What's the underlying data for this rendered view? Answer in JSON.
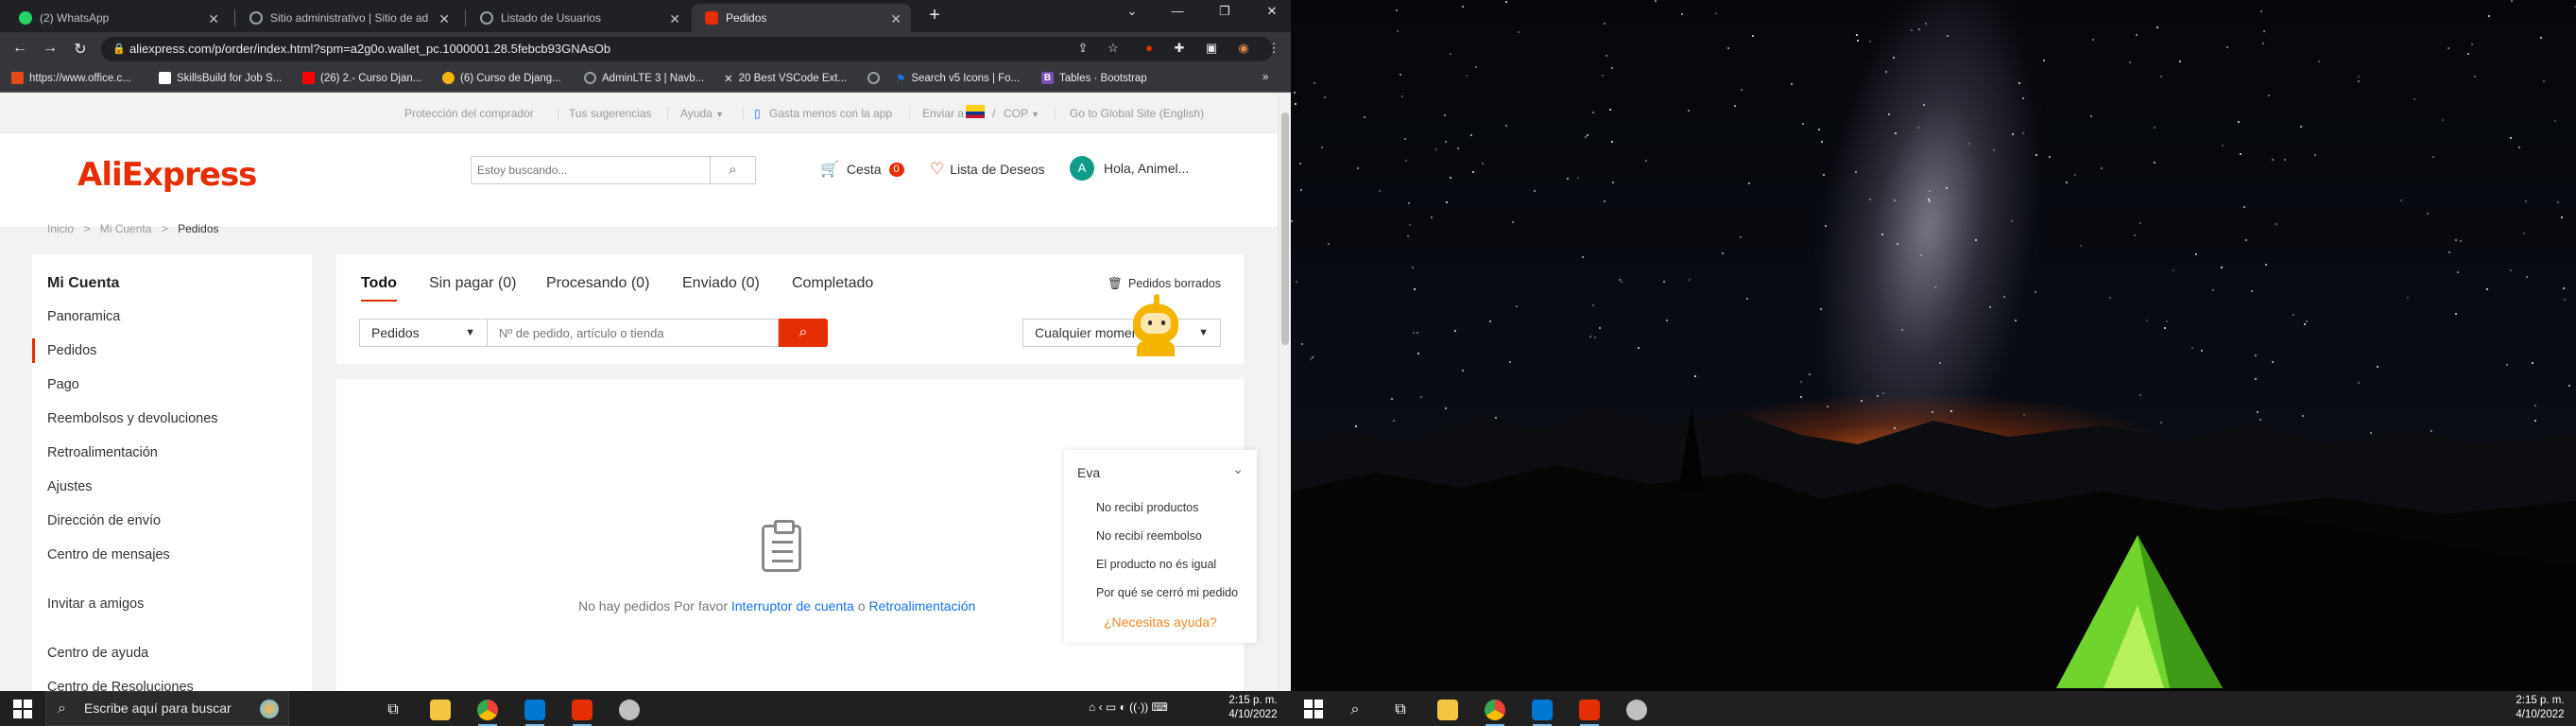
{
  "browser": {
    "tabs": [
      {
        "title": "(2) WhatsApp",
        "icon": "whatsapp-icon",
        "color": "#25d366"
      },
      {
        "title": "Sitio administrativo | Sitio de ad",
        "icon": "globe-icon",
        "color": "#9aa0a6"
      },
      {
        "title": "Listado de Usuarios",
        "icon": "globe-icon",
        "color": "#9aa0a6"
      },
      {
        "title": "Pedidos",
        "icon": "aliexpress-icon",
        "color": "#e62e04"
      }
    ],
    "url": "aliexpress.com/p/order/index.html?spm=a2g0o.wallet_pc.1000001.28.5febcb93GNAsOb",
    "bookmarks": [
      "https://www.office.c...",
      "SkillsBuild for Job S...",
      "(26) 2.- Curso Djan...",
      "(6) Curso de Djang...",
      "AdminLTE 3 | Navb...",
      "20 Best VSCode Ext...",
      "",
      "Search v5 Icons | Fo...",
      "Tables · Bootstrap"
    ]
  },
  "site": {
    "topnav": {
      "buyer_protection": "Protección del comprador",
      "suggestions": "Tus sugerencias",
      "help": "Ayuda",
      "app": "Gasta menos con la app",
      "ship_to": "Enviar a",
      "currency": "COP",
      "global": "Go to Global Site (English)"
    },
    "logo": "AliExpress",
    "search_placeholder": "Estoy buscando...",
    "cart_label": "Cesta",
    "cart_count": "0",
    "wishlist_label": "Lista de Deseos",
    "avatar_letter": "A",
    "greeting": "Hola, Animel...",
    "breadcrumb": [
      "Inicio",
      "Mi Cuenta",
      "Pedidos"
    ],
    "sidebar": {
      "title": "Mi Cuenta",
      "items": [
        "Panoramica",
        "Pedidos",
        "Pago",
        "Reembolsos y devoluciones",
        "Retroalimentación",
        "Ajustes",
        "Dirección de envío",
        "Centro de mensajes",
        "Invitar a amigos",
        "Centro de ayuda",
        "Centro de Resoluciones"
      ],
      "active": "Pedidos"
    },
    "orders": {
      "tabs": [
        "Todo",
        "Sin pagar (0)",
        "Procesando (0)",
        "Enviado (0)",
        "Completado"
      ],
      "active_tab": "Todo",
      "deleted_orders": "Pedidos borrados",
      "filter_type": "Pedidos",
      "search_placeholder": "Nº de pedido, artículo o tienda",
      "time_filter": "Cualquier momento",
      "empty_text": "No hay pedidos Por favor",
      "empty_link1": "Interruptor de cuenta",
      "empty_or": "o",
      "empty_link2": "Retroalimentación"
    },
    "assistant": {
      "name": "Eva",
      "options": [
        "No recibí productos",
        "No recibí reembolso",
        "El producto no és igual",
        "Por qué se cerró mi pedido"
      ],
      "help": "¿Necesitas ayuda?"
    }
  },
  "taskbar": {
    "search_placeholder": "Escribe aquí para buscar",
    "time": "2:15 p. m.",
    "date": "4/10/2022"
  },
  "colors": {
    "brand": "#e62e04",
    "link": "#1a73e8",
    "help": "#f08a24"
  }
}
